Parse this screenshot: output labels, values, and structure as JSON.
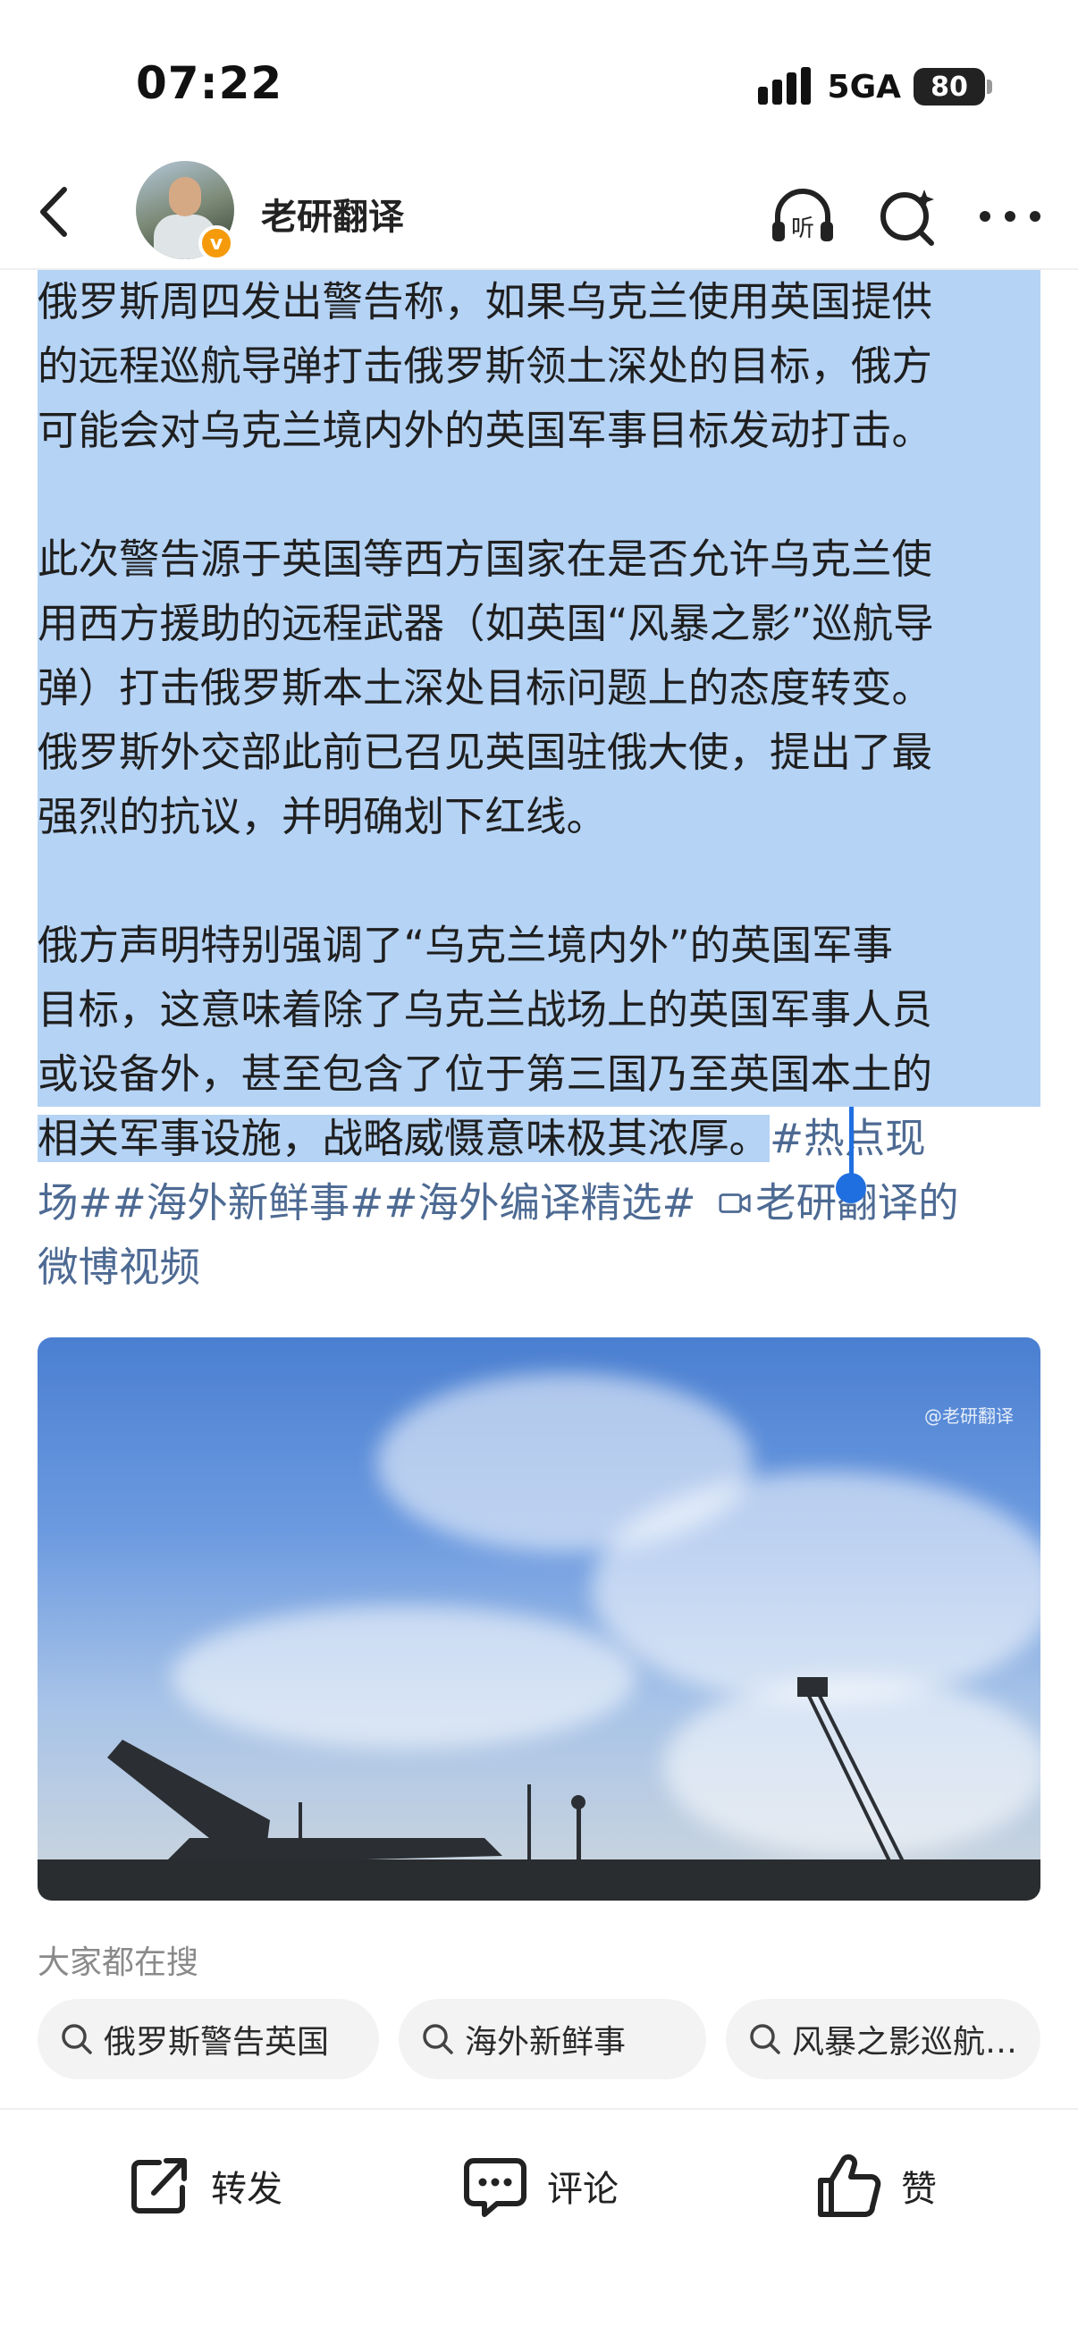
{
  "status": {
    "time": "07:22",
    "network": "5GA",
    "battery": "80"
  },
  "nav": {
    "author": "老研翻译",
    "verified_badge": "v"
  },
  "article": {
    "lines": [
      "俄罗斯周四发出警告称，如果乌克兰使用英国提供",
      "的远程巡航导弹打击俄罗斯领土深处的目标，俄方",
      "可能会对乌克兰境内外的英国军事目标发动打击。",
      "",
      "此次警告源于英国等西方国家在是否允许乌克兰使",
      "用西方援助的远程武器（如英国“风暴之影”巡航导",
      "弹）打击俄罗斯本土深处目标问题上的态度转变。",
      "俄罗斯外交部此前已召见英国驻俄大使，提出了最",
      "强烈的抗议，并明确划下红线。",
      "",
      "俄方声明特别强调了“乌克兰境内外”的英国军事",
      "目标，这意味着除了乌克兰战场上的英国军事人员",
      "或设备外，甚至包含了位于第三国乃至英国本土的"
    ],
    "last_selected_line": "相关军事设施，战略威慑意味极其浓厚。",
    "hashtag_part1": "#热点现",
    "hashtag_line2": "场##海外新鲜事##海外编译精选#",
    "video_link": "老研翻译的",
    "video_link_line2": "微博视频"
  },
  "video": {
    "watermark": "@老研翻译"
  },
  "search": {
    "label": "大家都在搜",
    "chips": [
      "俄罗斯警告英国",
      "海外新鲜事",
      "风暴之影巡航…"
    ]
  },
  "actions": {
    "repost": "转发",
    "comment": "评论",
    "like": "赞"
  },
  "colors": {
    "selection": "#b5d3f5",
    "link": "#4d6a93",
    "cursor": "#1f6fe0",
    "badge": "#f59b0b"
  }
}
